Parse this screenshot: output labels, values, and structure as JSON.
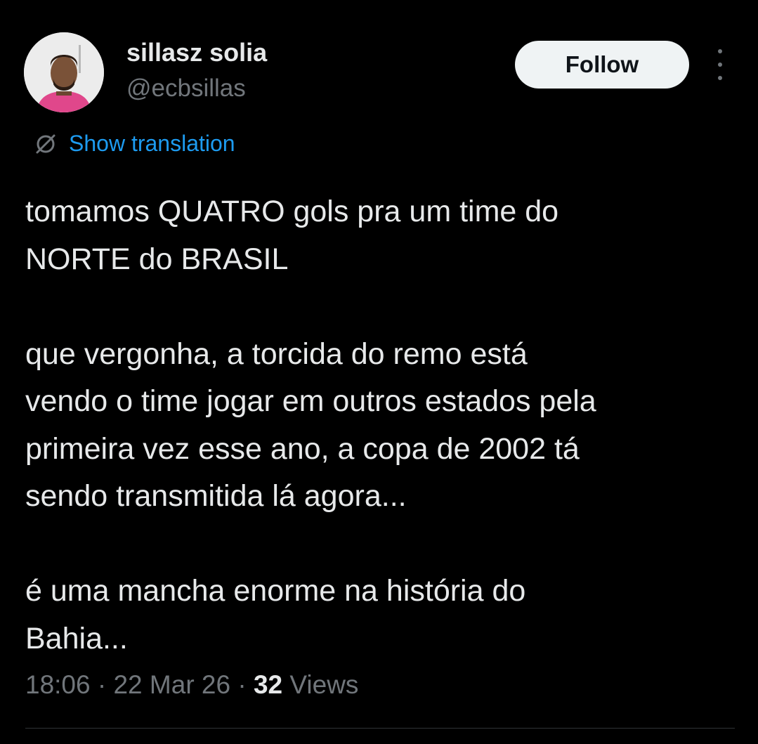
{
  "author": {
    "display_name": "sillasz solia",
    "handle": "@ecbsillas"
  },
  "follow_button": {
    "label": "Follow"
  },
  "more_menu": {
    "icon": "more-vertical-icon"
  },
  "translation": {
    "icon": "globe-icon",
    "label": "Show translation"
  },
  "tweet": {
    "paragraphs": [
      "tomamos QUATRO gols pra um time do\nNORTE do BRASIL",
      "que vergonha, a torcida do remo está\nvendo o time jogar em outros estados pela\nprimeira vez esse ano, a copa de 2002 tá\nsendo transmitida lá agora...",
      "é uma mancha enorme na história do\nBahia..."
    ]
  },
  "meta": {
    "time": "18:06",
    "separator": " · ",
    "date": "22 Mar 26",
    "views_count": "32",
    "views_label": "Views"
  },
  "colors": {
    "background": "#000000",
    "text": "#e7e9ea",
    "secondary": "#71767b",
    "link": "#1d9bf0",
    "follow_bg": "#eff3f4"
  }
}
